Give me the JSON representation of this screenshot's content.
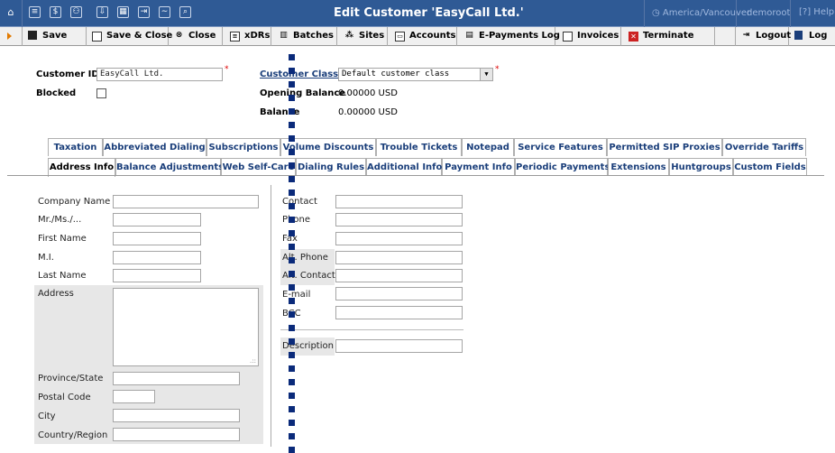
{
  "header": {
    "title": "Edit Customer 'EasyCall Ltd.'",
    "timezone": "America/Vancouver",
    "user": "demoroot",
    "help": "Help"
  },
  "toolbar": {
    "save": "Save",
    "save_close": "Save & Close",
    "close": "Close",
    "xdrs": "xDRs",
    "batches": "Batches",
    "sites": "Sites",
    "accounts": "Accounts",
    "epayments": "E-Payments Log",
    "invoices": "Invoices",
    "terminate": "Terminate",
    "logout": "Logout",
    "log": "Log"
  },
  "customer": {
    "id_label": "Customer ID",
    "id_value": "EasyCall Ltd.",
    "blocked_label": "Blocked",
    "class_label": "Customer Class",
    "class_value": "Default customer class",
    "opening_balance_label": "Opening Balance",
    "opening_balance_value": "0.00000 USD",
    "balance_label": "Balance",
    "balance_value": "0.00000 USD"
  },
  "tabs_row1": [
    "Taxation",
    "Abbreviated Dialing",
    "Subscriptions",
    "Volume Discounts",
    "Trouble Tickets",
    "Notepad",
    "Service Features",
    "Permitted SIP Proxies",
    "Override Tariffs"
  ],
  "tabs_row2": [
    "Address Info",
    "Balance Adjustments",
    "Web Self-Care",
    "Dialing Rules",
    "Additional Info",
    "Payment Info",
    "Periodic Payments",
    "Extensions",
    "Huntgroups",
    "Custom Fields"
  ],
  "address_left": {
    "company_name": "Company Name",
    "mr_ms": "Mr./Ms./...",
    "first_name": "First Name",
    "mi": "M.I.",
    "last_name": "Last Name",
    "address": "Address",
    "province": "Province/State",
    "postal_code": "Postal Code",
    "city": "City",
    "country": "Country/Region"
  },
  "address_right": {
    "contact": "Contact",
    "phone": "Phone",
    "fax": "Fax",
    "alt_phone": "Alt. Phone",
    "alt_contact": "Alt. Contact",
    "email": "E-mail",
    "bcc": "BCC",
    "description": "Description"
  },
  "colors": {
    "header_bg": "#2f5a95",
    "tab_text": "#1a3e7a",
    "required": "#dd0000",
    "dash": "#0a2a7a"
  }
}
